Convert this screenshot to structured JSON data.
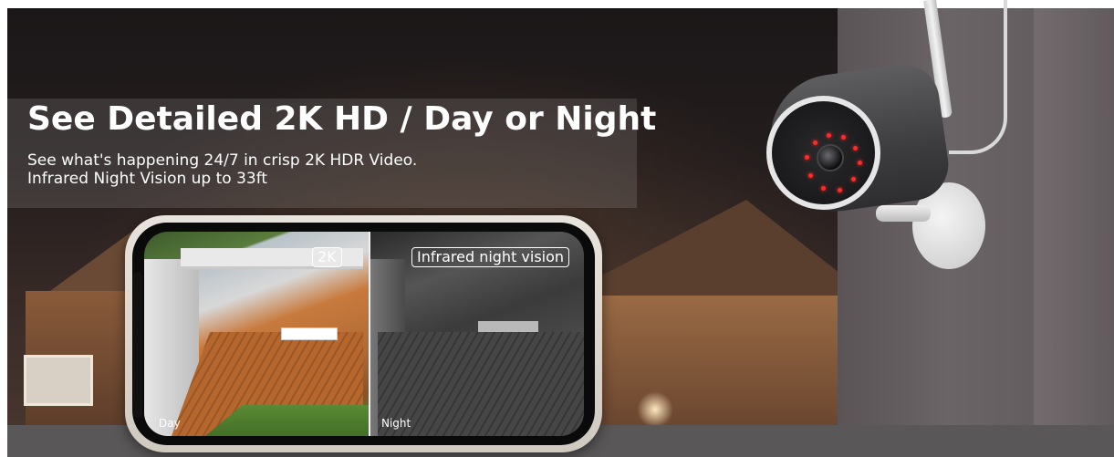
{
  "headline": "See Detailed 2K HD / Day or Night",
  "subheadline_lines": [
    "See what's happening 24/7 in crisp 2K HDR Video.",
    "Infrared Night Vision up to 33ft"
  ],
  "phone_screen": {
    "left_tag": "2K",
    "right_tag": "Infrared night vision",
    "left_caption": "Day",
    "right_caption": "Night"
  },
  "icons": {
    "camera": "security-camera-icon",
    "phone": "smartphone-icon"
  },
  "colors": {
    "headline_text": "#ffffff",
    "ir_led": "#ff2a2a",
    "wall": "#6b6466",
    "bottom_strip": "#5a5758"
  }
}
